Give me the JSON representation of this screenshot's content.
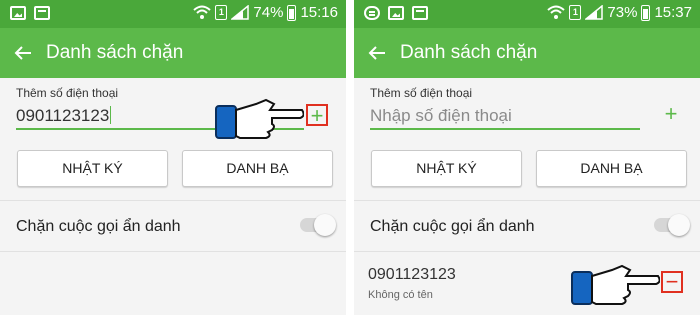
{
  "left": {
    "status": {
      "battery": "74%",
      "time": "15:16",
      "sim": "1"
    },
    "appbar": {
      "title": "Danh sách chặn"
    },
    "input": {
      "label": "Thêm số điện thoại",
      "value": "0901123123"
    },
    "buttons": {
      "log": "NHẬT KÝ",
      "contacts": "DANH BẠ"
    },
    "anon_row": {
      "label": "Chặn cuộc gọi ẩn danh",
      "toggle_on": false
    },
    "add_icon": "+"
  },
  "right": {
    "status": {
      "battery": "73%",
      "time": "15:37",
      "sim": "1"
    },
    "appbar": {
      "title": "Danh sách chặn"
    },
    "input": {
      "label": "Thêm số điện thoại",
      "placeholder": "Nhập số điện thoại"
    },
    "buttons": {
      "log": "NHẬT KÝ",
      "contacts": "DANH BẠ"
    },
    "anon_row": {
      "label": "Chặn cuộc gọi ẩn danh",
      "toggle_on": false
    },
    "add_icon": "+",
    "blocked_list": [
      {
        "number": "0901123123",
        "name": "Không có tên",
        "remove_icon": "−"
      }
    ]
  },
  "colors": {
    "statusbar": "#4aa83a",
    "appbar": "#5cb94a",
    "highlight": "#e03020",
    "pointer_cuff": "#1565c0"
  }
}
